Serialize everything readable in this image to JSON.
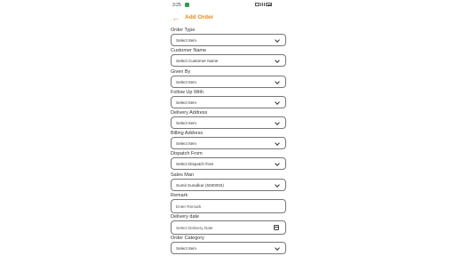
{
  "status": {
    "time": "3:25"
  },
  "appbar": {
    "title": "Add Order"
  },
  "form": {
    "fields": [
      {
        "label": "Order Type",
        "value": "Select Item",
        "control": "dropdown"
      },
      {
        "label": "Customer Name",
        "value": "Select Customer Name",
        "control": "dropdown"
      },
      {
        "label": "Given By",
        "value": "Select Item",
        "control": "dropdown"
      },
      {
        "label": "Follow Up With",
        "value": "Select Item",
        "control": "dropdown"
      },
      {
        "label": "Delivery Address",
        "value": "Select Item",
        "control": "dropdown"
      },
      {
        "label": "Billing Address",
        "value": "Select Item",
        "control": "dropdown"
      },
      {
        "label": "Dispatch From",
        "value": "Select Dispatch from",
        "control": "dropdown"
      },
      {
        "label": "Sales Man",
        "value": "Sumit Suradkar (5000093)",
        "control": "dropdown"
      },
      {
        "label": "Remark",
        "placeholder": "Enter Remark",
        "control": "text"
      },
      {
        "label": "Delivery date",
        "placeholder": "Select Delivery Date",
        "control": "date"
      },
      {
        "label": "Order Category",
        "value": "Select Item",
        "control": "dropdown"
      }
    ]
  },
  "colors": {
    "accent": "#e38a1b",
    "border": "#777777",
    "status_icon": "#2e9e4b"
  },
  "icons": {
    "back": "arrow-left-icon",
    "dropdown": "chevron-down-icon",
    "date": "calendar-icon"
  }
}
